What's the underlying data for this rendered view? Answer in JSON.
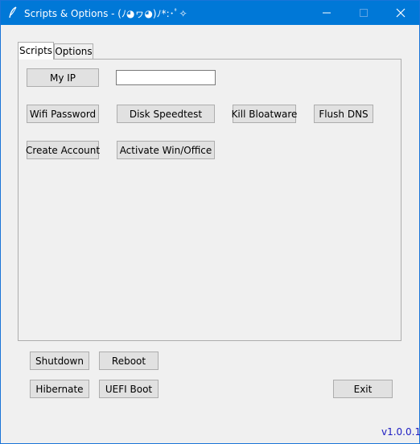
{
  "window": {
    "title": "Scripts & Options - (ﾉ◕ヮ◕)ﾉ*:･ﾟ✧",
    "icons": {
      "app": "feather-icon",
      "minimize": "minimize-icon",
      "maximize": "maximize-icon",
      "close": "close-icon"
    },
    "colors": {
      "titlebar": "#0078d7",
      "version_text": "#1c1cc2"
    }
  },
  "tabs": [
    {
      "label": "Scripts",
      "selected": true
    },
    {
      "label": "Options",
      "selected": false
    }
  ],
  "scripts": {
    "my_ip_label": "My IP",
    "ip_input_value": "",
    "wifi_password_label": "Wifi Password",
    "disk_speedtest_label": "Disk Speedtest",
    "kill_bloatware_label": "Kill Bloatware",
    "flush_dns_label": "Flush DNS",
    "create_account_label": "Create Account",
    "activate_label": "Activate Win/Office"
  },
  "power": {
    "shutdown_label": "Shutdown",
    "reboot_label": "Reboot",
    "hibernate_label": "Hibernate",
    "uefi_boot_label": "UEFI Boot"
  },
  "exit_label": "Exit",
  "version": "v1.0.0.1"
}
